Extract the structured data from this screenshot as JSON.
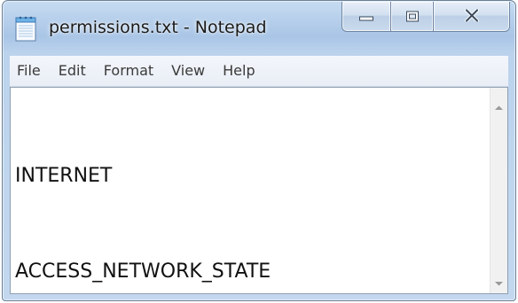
{
  "window": {
    "title": "permissions.txt - Notepad",
    "app_icon": "notepad-icon"
  },
  "caption_buttons": {
    "minimize_icon": "minimize-icon",
    "maximize_icon": "maximize-icon",
    "close_icon": "close-icon"
  },
  "menu": {
    "items": [
      {
        "label": "File"
      },
      {
        "label": "Edit"
      },
      {
        "label": "Format"
      },
      {
        "label": "View"
      },
      {
        "label": "Help"
      }
    ]
  },
  "editor": {
    "lines": [
      "INTERNET",
      "ACCESS_NETWORK_STATE"
    ]
  },
  "scrollbar": {
    "up_icon": "scroll-up-arrow-icon",
    "down_icon": "scroll-down-arrow-icon"
  },
  "colors": {
    "frame": "#b9d1ec",
    "menubar": "#eef2f8",
    "text": "#111111"
  }
}
